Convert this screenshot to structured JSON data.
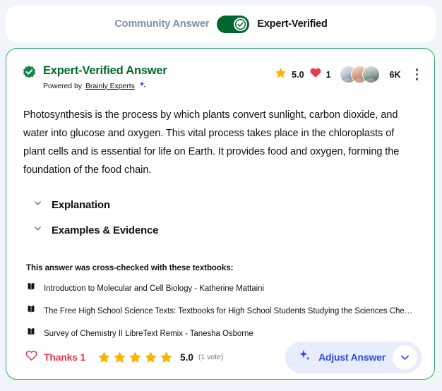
{
  "toggle": {
    "inactive_label": "Community Answer",
    "active_label": "Expert-Verified",
    "state": "expert-verified",
    "track_color": "#00672e"
  },
  "answer": {
    "header": {
      "title": "Expert-Verified Answer",
      "title_color": "#00672e",
      "powered_prefix": "Powered by",
      "powered_link": "Brainly Experts"
    },
    "stats": {
      "star_rating": "5.0",
      "hearts": "1",
      "viewers": "6K",
      "star_color": "#f7b500",
      "heart_color": "#e8384f"
    },
    "body_text": "Photosynthesis is the process by which plants convert sunlight, carbon dioxide, and water into glucose and oxygen. This vital process takes place in the chloroplasts of plant cells and is essential for life on Earth. It provides food and oxygen, forming the foundation of the food chain.",
    "sections": [
      {
        "label": "Explanation"
      },
      {
        "label": "Examples & Evidence"
      }
    ],
    "textbooks": {
      "heading": "This answer was cross-checked with these textbooks:",
      "items": [
        {
          "title": "Introduction to Molecular and Cell Biology - Katherine Mattaini"
        },
        {
          "title": "The Free High School Science Texts: Textbooks for High School Students Studying the Sciences Chemistry - FHS..."
        },
        {
          "title": "Survey of Chemistry II LibreText Remix - Tanesha Osborne"
        }
      ]
    },
    "footer": {
      "thanks_label": "Thanks 1",
      "stars_filled": 5,
      "rating_value": "5.0",
      "rating_votes": "(1 vote)",
      "adjust_label": "Adjust Answer",
      "adjust_color": "#2d4ae8"
    }
  }
}
